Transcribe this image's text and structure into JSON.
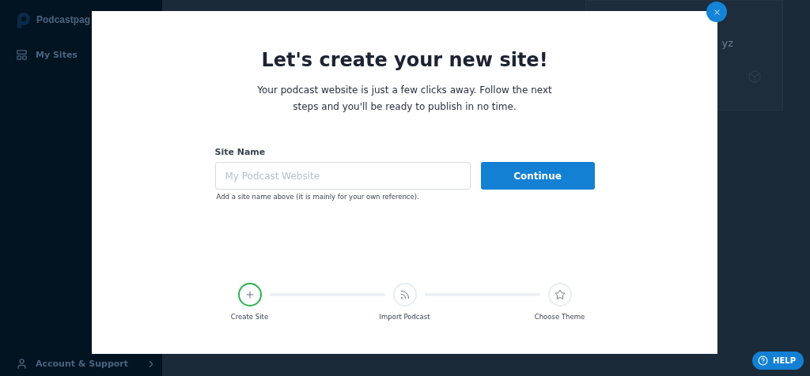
{
  "sidebar": {
    "brand": "Podcastpag",
    "items": [
      {
        "label": "My Sites",
        "selected": false
      }
    ],
    "footer": {
      "label": "Account & Support"
    }
  },
  "background_card": {
    "text": "yz"
  },
  "modal": {
    "title": "Let's create your new site!",
    "subtitle": "Your podcast website is just a few clicks away. Follow the next steps and you'll be ready to publish in no time.",
    "field": {
      "label": "Site Name",
      "placeholder": "My Podcast Website",
      "hint": "Add a site name above (it is mainly for your own reference)."
    },
    "button": "Continue",
    "steps": [
      {
        "kind": "plus",
        "label": "Create Site",
        "active": true
      },
      {
        "kind": "rss",
        "label": "Import Podcast",
        "active": false
      },
      {
        "kind": "star",
        "label": "Choose Theme",
        "active": false
      }
    ]
  },
  "help": {
    "label": "HELP"
  }
}
